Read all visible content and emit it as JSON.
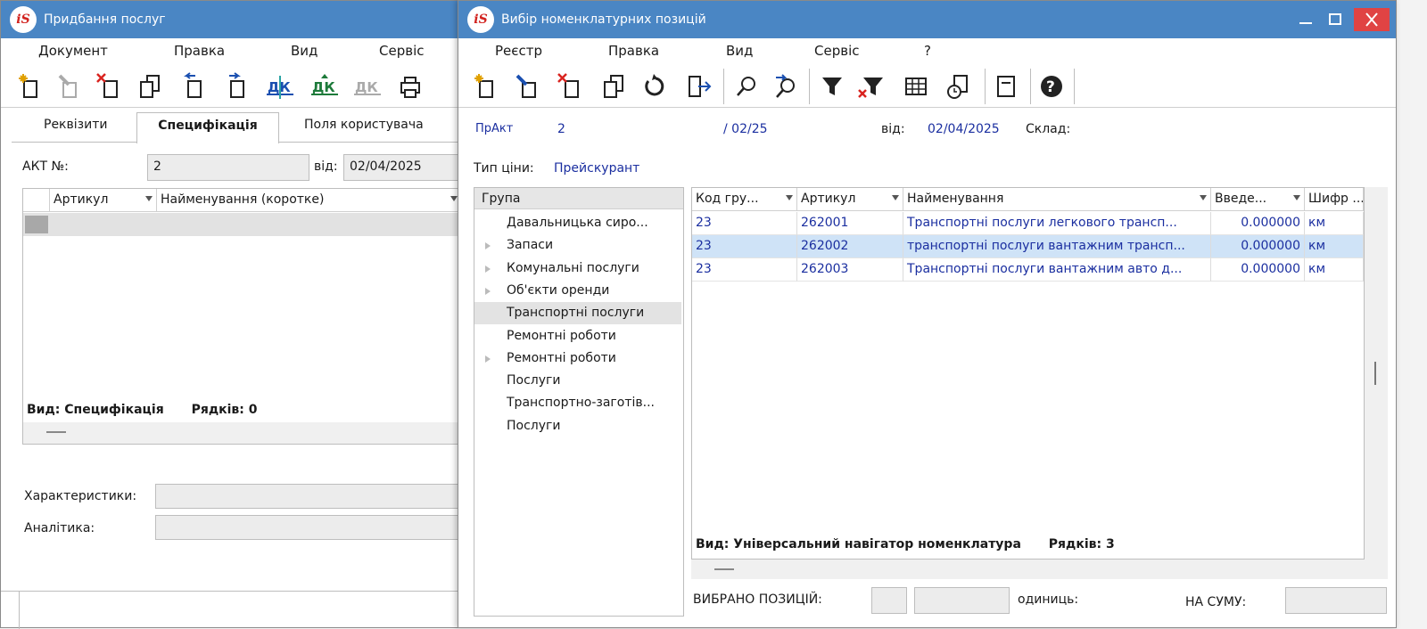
{
  "win1": {
    "title": "Придбання послуг",
    "menu": [
      "Документ",
      "Правка",
      "Вид",
      "Сервіс"
    ],
    "tabs": [
      "Реквізити",
      "Специфікація",
      "Поля користувача"
    ],
    "act_label": "АКТ №:",
    "act_value": "2",
    "date_label": "від:",
    "date_value": "02/04/2025",
    "grid_headers": [
      "Артикул",
      "Найменування (коротке)"
    ],
    "status_view": "Вид: Специфікація",
    "status_rows": "Рядків: 0",
    "char_label": "Характеристики:",
    "anal_label": "Аналітика:"
  },
  "win2": {
    "title": "Вибір номенклатурних позицій",
    "menu": [
      "Реєстр",
      "Правка",
      "Вид",
      "Сервіс",
      "?"
    ],
    "doc_type": "ПрАкт",
    "doc_num": "2",
    "doc_period": "/ 02/25",
    "date_label": "від:",
    "date_value": "02/04/2025",
    "warehouse_label": "Склад:",
    "price_label": "Тип ціни:",
    "price_value": "Прейскурант",
    "tree_header": "Група",
    "tree": [
      {
        "label": "Давальницька сиро...",
        "expandable": false
      },
      {
        "label": "Запаси",
        "expandable": true
      },
      {
        "label": "Комунальні послуги",
        "expandable": true
      },
      {
        "label": "Об'єкти оренди",
        "expandable": true
      },
      {
        "label": "Транспортні послуги",
        "expandable": false,
        "selected": true
      },
      {
        "label": "Ремонтні роботи",
        "expandable": false
      },
      {
        "label": "Ремонтні роботи",
        "expandable": true
      },
      {
        "label": "Послуги",
        "expandable": false
      },
      {
        "label": "Транспортно-заготів...",
        "expandable": false
      },
      {
        "label": "Послуги",
        "expandable": false
      }
    ],
    "columns": [
      "Код гру...",
      "Артикул",
      "Найменування",
      "Введе...",
      "Шифр ..."
    ],
    "rows": [
      {
        "group": "23",
        "article": "262001",
        "name": "Транспортні послуги легкового трансп...",
        "qty": "0.000000",
        "unit": "км"
      },
      {
        "group": "23",
        "article": "262002",
        "name": "транспортні послуги вантажним трансп...",
        "qty": "0.000000",
        "unit": "км"
      },
      {
        "group": "23",
        "article": "262003",
        "name": "Транспортні послуги вантажним авто д...",
        "qty": "0.000000",
        "unit": "км"
      }
    ],
    "status_view": "Вид: Універсальний навігатор номенклатура",
    "status_rows": "Рядків: 3",
    "selected_label": "ВИБРАНО ПОЗИЦІЙ:",
    "units_label": "одиниць:",
    "sum_label": "НА СУМУ:"
  },
  "colors": {
    "titlebar": "#4a86c4",
    "close": "#e04343",
    "selected_row": "#cfe3f7",
    "link_text": "#1b2fa0"
  }
}
